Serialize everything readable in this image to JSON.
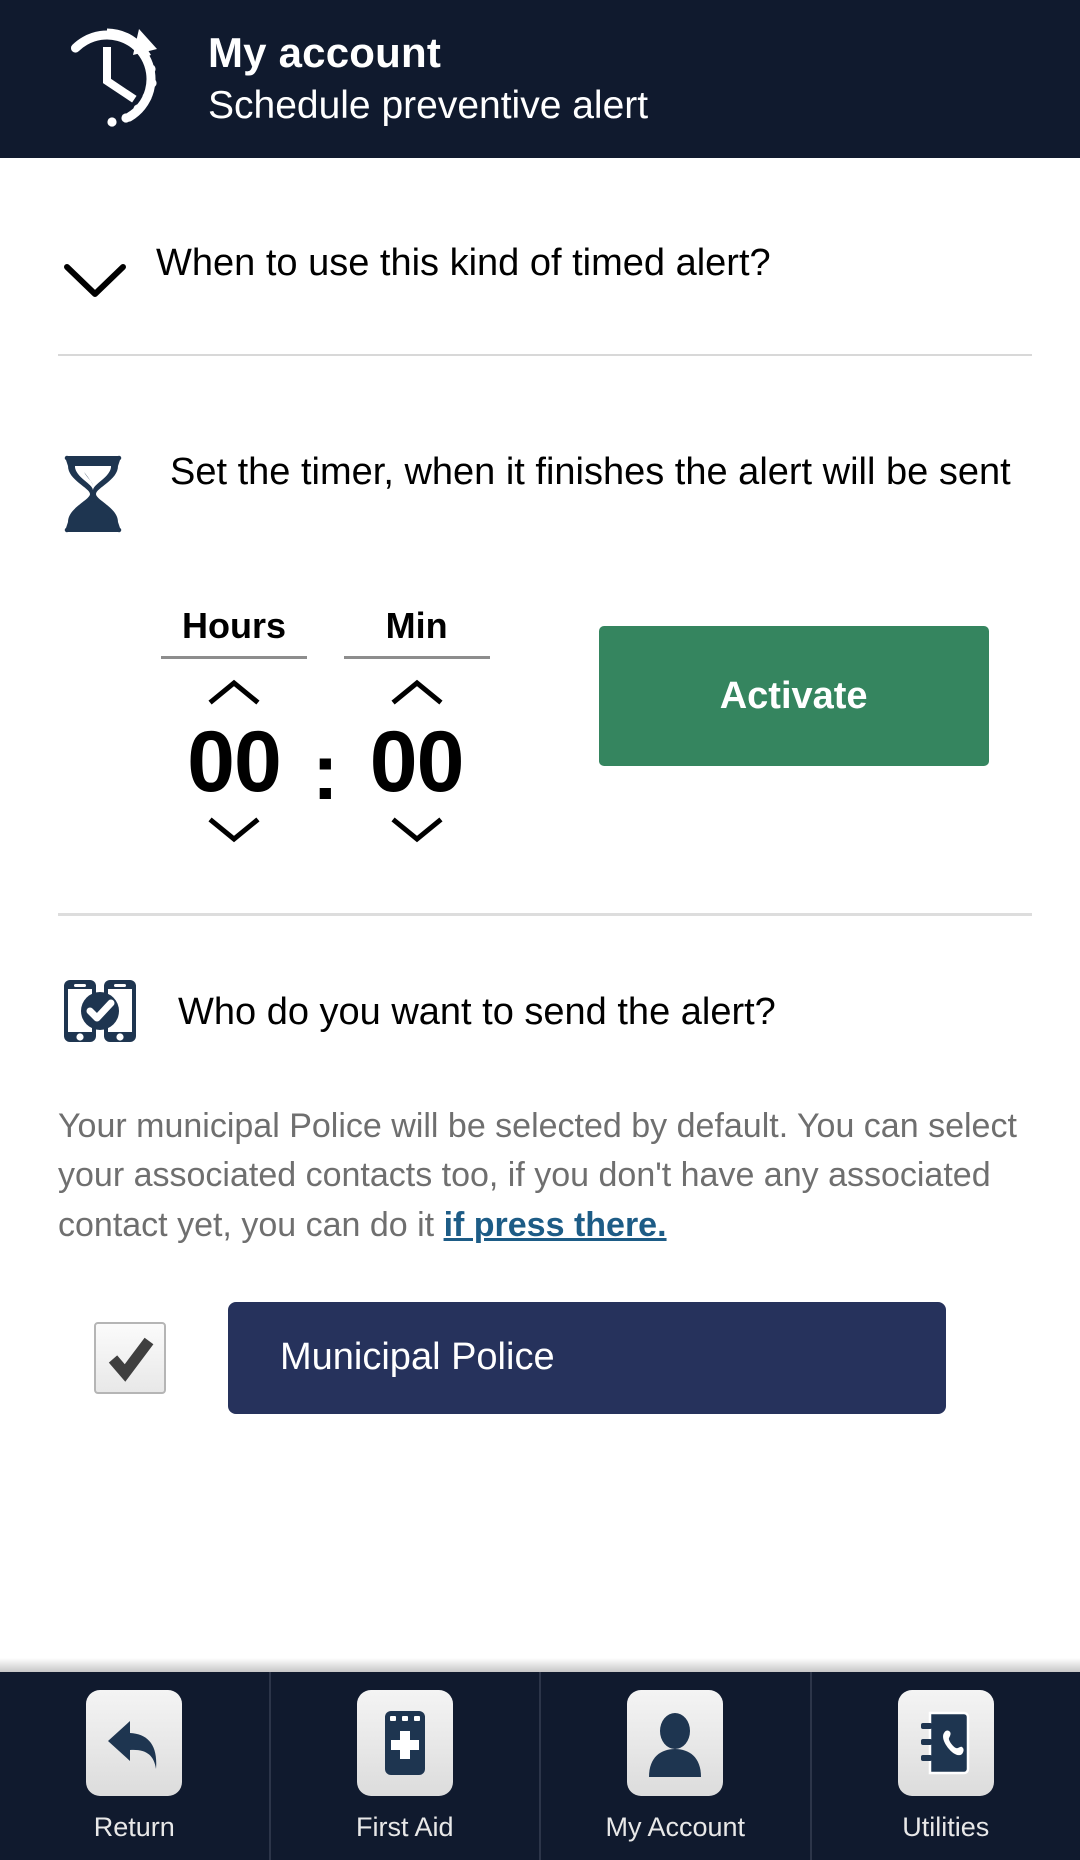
{
  "header": {
    "icon": "clock-arrow-icon",
    "title": "My account",
    "subtitle": "Schedule preventive alert",
    "bg_color": "#101a2e"
  },
  "accordion": {
    "icon": "chevron-down-icon",
    "label": "When to use this kind of timed alert?"
  },
  "timer_section": {
    "icon": "hourglass-icon",
    "description": "Set the timer, when it finishes the alert will be sent",
    "hours": {
      "label": "Hours",
      "value": "00",
      "increment_icon": "chevron-up-icon",
      "decrement_icon": "chevron-down-icon"
    },
    "separator": ":",
    "minutes": {
      "label": "Min",
      "value": "00",
      "increment_icon": "chevron-up-icon",
      "decrement_icon": "chevron-down-icon"
    },
    "activate_label": "Activate",
    "activate_color": "#35855f"
  },
  "recipients_section": {
    "icon": "two-phones-check-icon",
    "title": "Who do you want to send the alert?",
    "description_before": "Your municipal Police will be selected by default. You can select your associated contacts too, if you don't have any associated contact yet, you can do it ",
    "link_text": "if press there.",
    "link_color": "#1d5c86",
    "recipient": {
      "checked": true,
      "check_icon": "checkmark-icon",
      "label": "Municipal Police",
      "color": "#26325c"
    }
  },
  "bottom_nav": {
    "items": [
      {
        "icon": "back-arrow-icon",
        "label": "Return"
      },
      {
        "icon": "first-aid-phone-icon",
        "label": "First Aid"
      },
      {
        "icon": "person-icon",
        "label": "My Account"
      },
      {
        "icon": "phonebook-icon",
        "label": "Utilities"
      }
    ]
  }
}
